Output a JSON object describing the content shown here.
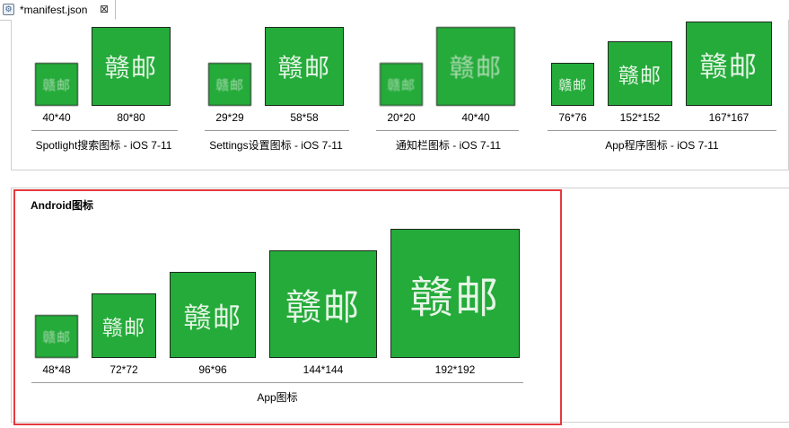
{
  "tab": {
    "title": "*manifest.json",
    "close_glyph": "⊠"
  },
  "icon_text": "赣邮",
  "icon_color": "#24ab3a",
  "highlight_color": "#e5393e",
  "ios": {
    "groups": [
      {
        "label": "Spotlight搜索图标 - iOS 7-11",
        "sizes": [
          "40*40",
          "80*80"
        ]
      },
      {
        "label": "Settings设置图标 - iOS 7-11",
        "sizes": [
          "29*29",
          "58*58"
        ]
      },
      {
        "label": "通知栏图标 - iOS 7-11",
        "sizes": [
          "20*20",
          "40*40"
        ]
      },
      {
        "label": "App程序图标 - iOS 7-11",
        "sizes": [
          "76*76",
          "152*152",
          "167*167"
        ]
      }
    ]
  },
  "android": {
    "title": "Android图标",
    "group_label": "App图标",
    "sizes": [
      "48*48",
      "72*72",
      "96*96",
      "144*144",
      "192*192"
    ]
  }
}
